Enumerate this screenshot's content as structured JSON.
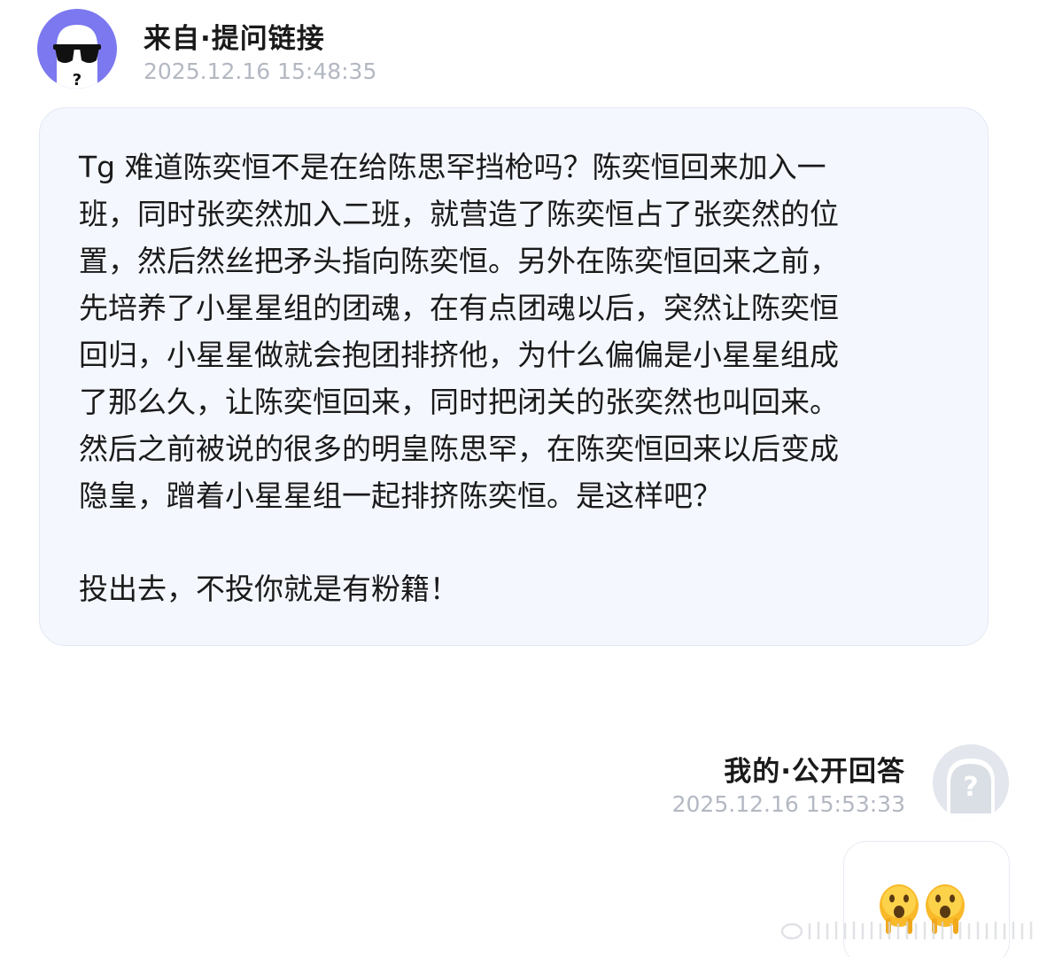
{
  "question": {
    "title": "来自·提问链接",
    "timestamp": "2025.12.16 15:48:35",
    "avatar_icon": "sunglasses-ghost-avatar-icon",
    "avatar_color": "#7b78f0",
    "paragraphs": [
      "Tg 难道陈奕恒不是在给陈思罕挡枪吗？陈奕恒回来加入一\n班，同时张奕然加入二班，就营造了陈奕恒占了张奕然的位\n置，然后然丝把矛头指向陈奕恒。另外在陈奕恒回来之前，\n先培养了小星星组的团魂，在有点团魂以后，突然让陈奕恒\n回归，小星星做就会抱团排挤他，为什么偏偏是小星星组成\n了那么久，让陈奕恒回来，同时把闭关的张奕然也叫回来。\n然后之前被说的很多的明皇陈思罕，在陈奕恒回来以后变成\n隐皇，蹭着小星星组一起排挤陈奕恒。是这样吧？",
      "投出去，不投你就是有粉籍！"
    ]
  },
  "answer": {
    "title": "我的·公开回答",
    "timestamp": "2025.12.16 15:53:33",
    "avatar_icon": "question-mark-ghost-avatar-icon",
    "emojis": [
      "hushed-face-emoji",
      "hushed-face-emoji"
    ]
  },
  "colors": {
    "bubble_background": "#f4f7fd",
    "timestamp_text": "#b3b8c2",
    "avatar_purple": "#7b78f0"
  }
}
